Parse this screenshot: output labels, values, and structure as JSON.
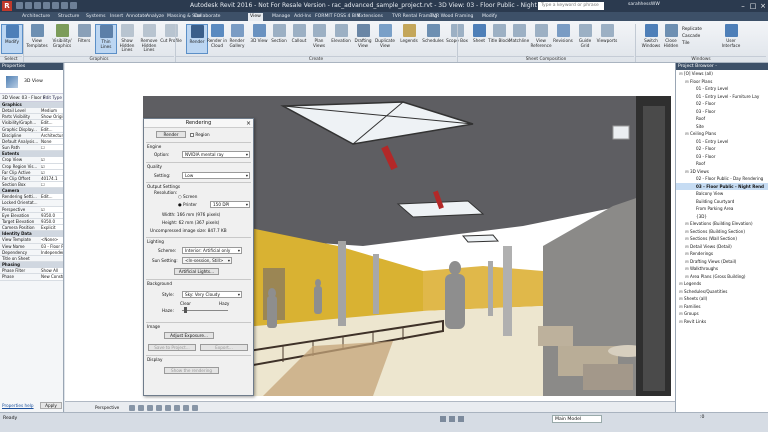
{
  "titlebar": {
    "title": "Autodesk Revit 2016 - Not For Resale Version  -  rac_advanced_sample_project.rvt - 3D View: 03 - Floor Public - Night Rendering",
    "search_placeholder": "Type a keyword or phrase",
    "user": "sarahhessWW"
  },
  "tabs": [
    "Architecture",
    "Structure",
    "Systems",
    "Insert",
    "Annotate",
    "Analyze",
    "Massing & Site",
    "Collaborate",
    "View",
    "Manage",
    "Add-Ins",
    "FORMIT",
    "FOSS 4 BIM",
    "Extensions",
    "TVR Rental Framing",
    "TVR Wood Framing",
    "Modify"
  ],
  "active_tab": "View",
  "ribbon": {
    "buttons": [
      {
        "label": "Modify",
        "active": true
      },
      {
        "label": "View Templates",
        "active": false
      },
      {
        "label": "Visibility/ Graphics",
        "active": false
      },
      {
        "label": "Filters",
        "active": false
      },
      {
        "label": "Thin Lines",
        "active": true
      },
      {
        "label": "Show Hidden Lines",
        "active": false
      },
      {
        "label": "Remove Hidden Lines",
        "active": false
      },
      {
        "label": "Cut Profile",
        "active": false
      },
      {
        "label": "Render",
        "active": true
      },
      {
        "label": "Render in Cloud",
        "active": false
      },
      {
        "label": "Render Gallery",
        "active": false
      },
      {
        "label": "3D View",
        "active": false
      },
      {
        "label": "Section",
        "active": false
      },
      {
        "label": "Callout",
        "active": false
      },
      {
        "label": "Plan Views",
        "active": false
      },
      {
        "label": "Elevation",
        "active": false
      },
      {
        "label": "Drafting View",
        "active": false
      },
      {
        "label": "Duplicate View",
        "active": false
      },
      {
        "label": "Legends",
        "active": false
      },
      {
        "label": "Schedules",
        "active": false
      },
      {
        "label": "Scope Box",
        "active": false
      },
      {
        "label": "Sheet",
        "active": false
      },
      {
        "label": "Title Block",
        "active": false
      },
      {
        "label": "Matchline",
        "active": false
      },
      {
        "label": "View Reference",
        "active": false
      },
      {
        "label": "Revisions",
        "active": false
      },
      {
        "label": "Guide Grid",
        "active": false
      },
      {
        "label": "Viewports",
        "active": false
      },
      {
        "label": "Switch Windows",
        "active": false
      },
      {
        "label": "Close Hidden",
        "active": false
      },
      {
        "label": "User Interface",
        "active": false
      }
    ],
    "window_items": [
      "Replicate",
      "Cascade",
      "Tile"
    ],
    "panels": [
      "Graphics",
      "Create",
      "Sheet Composition",
      "Windows"
    ],
    "select_label": "Select"
  },
  "properties": {
    "header": "Properties",
    "type_name": "3D View",
    "instance_selector": "3D View: 03 - Floor P",
    "edit_type": "Edit Type",
    "groups": [
      {
        "name": "Graphics",
        "rows": [
          {
            "k": "Detail Level",
            "v": "Medium"
          },
          {
            "k": "Parts Visibility",
            "v": "Show Origi"
          },
          {
            "k": "Visibility/Graph...",
            "v": "Edit..."
          },
          {
            "k": "Graphic Display...",
            "v": "Edit..."
          },
          {
            "k": "Discipline",
            "v": "Architectur"
          },
          {
            "k": "Default Analysis...",
            "v": "None"
          },
          {
            "k": "Sun Path",
            "v": "☐"
          }
        ]
      },
      {
        "name": "Extents",
        "rows": [
          {
            "k": "Crop View",
            "v": "☑"
          },
          {
            "k": "Crop Region Vis...",
            "v": "☑"
          },
          {
            "k": "Far Clip Active",
            "v": "☑"
          },
          {
            "k": "Far Clip Offset",
            "v": "40174.1"
          },
          {
            "k": "Section Box",
            "v": "☐"
          }
        ]
      },
      {
        "name": "Camera",
        "rows": [
          {
            "k": "Rendering Setti...",
            "v": "Edit..."
          },
          {
            "k": "Locked Orientat...",
            "v": ""
          },
          {
            "k": "Perspective",
            "v": "☑"
          },
          {
            "k": "Eye Elevation",
            "v": "9350.0"
          },
          {
            "k": "Target Elevation",
            "v": "9350.0"
          },
          {
            "k": "Camera Position",
            "v": "Explicit"
          }
        ]
      },
      {
        "name": "Identity Data",
        "rows": [
          {
            "k": "View Template",
            "v": "<None>"
          },
          {
            "k": "View Name",
            "v": "03 - Floor P"
          },
          {
            "k": "Dependency",
            "v": "Independen"
          },
          {
            "k": "Title on Sheet",
            "v": ""
          }
        ]
      },
      {
        "name": "Phasing",
        "rows": [
          {
            "k": "Phase Filter",
            "v": "Show All"
          },
          {
            "k": "Phase",
            "v": "New Construction"
          }
        ]
      }
    ],
    "help_link": "Properties help",
    "apply": "Apply"
  },
  "dialog": {
    "title": "Rendering",
    "render_btn": "Render",
    "region_label": "Region",
    "engine_label": "Engine",
    "option_label": "Option:",
    "option_value": "NVIDIA mental ray",
    "quality_label": "Quality",
    "setting_label": "Setting:",
    "setting_value": "Low",
    "output_label": "Output Settings",
    "resolution_label": "Resolution:",
    "screen_label": "Screen",
    "printer_label": "Printer",
    "dpi_value": "150 DPI",
    "width": "Width:    166 mm (976 pixels)",
    "height": "Height:   62 mm (367 pixels)",
    "size": "Uncompressed image size:  847.7 KB",
    "lighting_label": "Lighting",
    "scheme_label": "Scheme:",
    "scheme_value": "Interior: Artificial only",
    "sun_label": "Sun Setting:",
    "sun_value": "<In-session, Still>",
    "artificial_btn": "Artificial Lights...",
    "background_label": "Background",
    "style_label": "Style:",
    "style_value": "Sky: Very Cloudy",
    "clear_label": "Clear",
    "hazy_label": "Hazy",
    "haze_label": "Haze:",
    "image_label": "Image",
    "adjust_btn": "Adjust Exposure...",
    "save_btn": "Save to Project...",
    "export_btn": "Export...",
    "display_label": "Display",
    "show_btn": "Show the rendering"
  },
  "browser": {
    "header": "Project Browser - rac_advanced_sampl...",
    "items": [
      {
        "t": "[O] Views (all)",
        "lvl": 0,
        "sel": false
      },
      {
        "t": "Floor Plans",
        "lvl": 1,
        "sel": false
      },
      {
        "t": "01 - Entry Level",
        "lvl": 2,
        "sel": false
      },
      {
        "t": "01 - Entry Level - Furniture Lay",
        "lvl": 2,
        "sel": false
      },
      {
        "t": "02 - Floor",
        "lvl": 2,
        "sel": false
      },
      {
        "t": "03 - Floor",
        "lvl": 2,
        "sel": false
      },
      {
        "t": "Roof",
        "lvl": 2,
        "sel": false
      },
      {
        "t": "Site",
        "lvl": 2,
        "sel": false
      },
      {
        "t": "Ceiling Plans",
        "lvl": 1,
        "sel": false
      },
      {
        "t": "01 - Entry Level",
        "lvl": 2,
        "sel": false
      },
      {
        "t": "02 - Floor",
        "lvl": 2,
        "sel": false
      },
      {
        "t": "03 - Floor",
        "lvl": 2,
        "sel": false
      },
      {
        "t": "Roof",
        "lvl": 2,
        "sel": false
      },
      {
        "t": "3D Views",
        "lvl": 1,
        "sel": false
      },
      {
        "t": "02 - Floor Public - Day Rendering",
        "lvl": 2,
        "sel": false
      },
      {
        "t": "03 - Floor Public - Night Rend",
        "lvl": 2,
        "sel": true
      },
      {
        "t": "Balcony View",
        "lvl": 2,
        "sel": false
      },
      {
        "t": "Building Courtyard",
        "lvl": 2,
        "sel": false
      },
      {
        "t": "From Parking Area",
        "lvl": 2,
        "sel": false
      },
      {
        "t": "{3D}",
        "lvl": 2,
        "sel": false
      },
      {
        "t": "Elevations (Building Elevation)",
        "lvl": 1,
        "sel": false
      },
      {
        "t": "Sections (Building Section)",
        "lvl": 1,
        "sel": false
      },
      {
        "t": "Sections (Wall Section)",
        "lvl": 1,
        "sel": false
      },
      {
        "t": "Detail Views (Detail)",
        "lvl": 1,
        "sel": false
      },
      {
        "t": "Renderings",
        "lvl": 1,
        "sel": false
      },
      {
        "t": "Drafting Views (Detail)",
        "lvl": 1,
        "sel": false
      },
      {
        "t": "Walkthroughs",
        "lvl": 1,
        "sel": false
      },
      {
        "t": "Area Plans (Gross Building)",
        "lvl": 1,
        "sel": false
      },
      {
        "t": "Legends",
        "lvl": 0,
        "sel": false
      },
      {
        "t": "Schedules/Quantities",
        "lvl": 0,
        "sel": false
      },
      {
        "t": "Sheets (all)",
        "lvl": 0,
        "sel": false
      },
      {
        "t": "Families",
        "lvl": 0,
        "sel": false
      },
      {
        "t": "Groups",
        "lvl": 0,
        "sel": false
      },
      {
        "t": "Revit Links",
        "lvl": 0,
        "sel": false
      }
    ]
  },
  "viewbar": {
    "label": "Perspective"
  },
  "status": {
    "text": "Ready",
    "model": "Main Model",
    "filter": ":0"
  }
}
